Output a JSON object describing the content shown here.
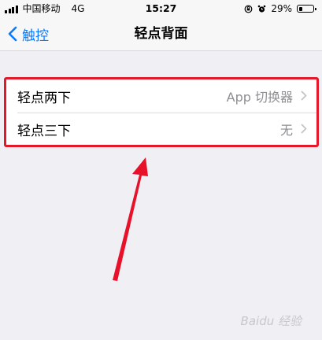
{
  "status": {
    "carrier": "中国移动",
    "network": "4G",
    "time": "15:27",
    "battery": "29%",
    "battery_level": 0.29
  },
  "nav": {
    "back_label": "触控",
    "title": "轻点背面"
  },
  "rows": [
    {
      "label": "轻点两下",
      "value": "App 切换器"
    },
    {
      "label": "轻点三下",
      "value": "无"
    }
  ],
  "watermark": "Baidu 经验",
  "colors": {
    "accent": "#0a7aff",
    "highlight": "#e3192a",
    "background": "#efeff4"
  }
}
